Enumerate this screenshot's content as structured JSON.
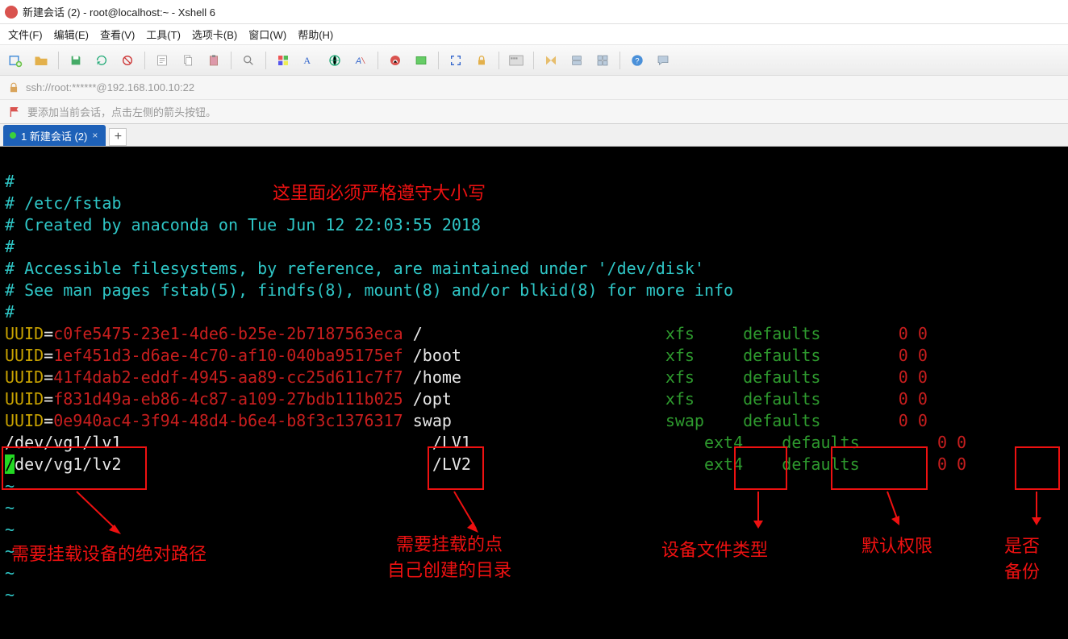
{
  "window": {
    "title": "新建会话 (2) - root@localhost:~ - Xshell 6"
  },
  "menu": {
    "file": "文件(F)",
    "edit": "编辑(E)",
    "view": "查看(V)",
    "tools": "工具(T)",
    "tabs": "选项卡(B)",
    "window": "窗口(W)",
    "help": "帮助(H)"
  },
  "address": {
    "text": "ssh://root:******@192.168.100.10:22"
  },
  "hint": {
    "text": "要添加当前会话，点击左侧的箭头按钮。"
  },
  "tab": {
    "label": "1 新建会话 (2)"
  },
  "annotations": {
    "top": "这里面必须严格遵守大小写",
    "path": "需要挂载设备的绝对路径",
    "mount": "需要挂载的点\n自己创建的目录",
    "fstype": "设备文件类型",
    "opts": "默认权限",
    "dump": "是否\n备份"
  },
  "fstab": {
    "comments": [
      "#",
      "# /etc/fstab",
      "# Created by anaconda on Tue Jun 12 22:03:55 2018",
      "#",
      "# Accessible filesystems, by reference, are maintained under '/dev/disk'",
      "# See man pages fstab(5), findfs(8), mount(8) and/or blkid(8) for more info",
      "#"
    ],
    "rows": [
      {
        "uuid": "c0fe5475-23e1-4de6-b25e-2b7187563eca",
        "mnt": "/",
        "fs": "xfs",
        "opt": "defaults",
        "d": "0",
        "p": "0"
      },
      {
        "uuid": "1ef451d3-d6ae-4c70-af10-040ba95175ef",
        "mnt": "/boot",
        "fs": "xfs",
        "opt": "defaults",
        "d": "0",
        "p": "0"
      },
      {
        "uuid": "41f4dab2-eddf-4945-aa89-cc25d611c7f7",
        "mnt": "/home",
        "fs": "xfs",
        "opt": "defaults",
        "d": "0",
        "p": "0"
      },
      {
        "uuid": "f831d49a-eb86-4c87-a109-27bdb111b025",
        "mnt": "/opt",
        "fs": "xfs",
        "opt": "defaults",
        "d": "0",
        "p": "0"
      },
      {
        "uuid": "0e940ac4-3f94-48d4-b6e4-b8f3c1376317",
        "mnt": "swap",
        "fs": "swap",
        "opt": "defaults",
        "d": "0",
        "p": "0"
      }
    ],
    "extra": [
      {
        "dev": "/dev/vg1/lv1",
        "mnt": "/LV1",
        "fs": "ext4",
        "opt": "defaults",
        "d": "0",
        "p": "0"
      },
      {
        "dev": "/dev/vg1/lv2",
        "mnt": "/LV2",
        "fs": "ext4",
        "opt": "defaults",
        "d": "0",
        "p": "0"
      }
    ]
  },
  "toolbar_icons": [
    "new-session",
    "open",
    "save",
    "reconnect",
    "disconnect",
    "properties",
    "copy",
    "paste",
    "search",
    "color-scheme",
    "font",
    "encoding",
    "transparency",
    "xagent",
    "xftp",
    "fullscreen",
    "lock",
    "compose-bar",
    "tile-h",
    "tile-v",
    "tile-g",
    "help",
    "feedback"
  ]
}
